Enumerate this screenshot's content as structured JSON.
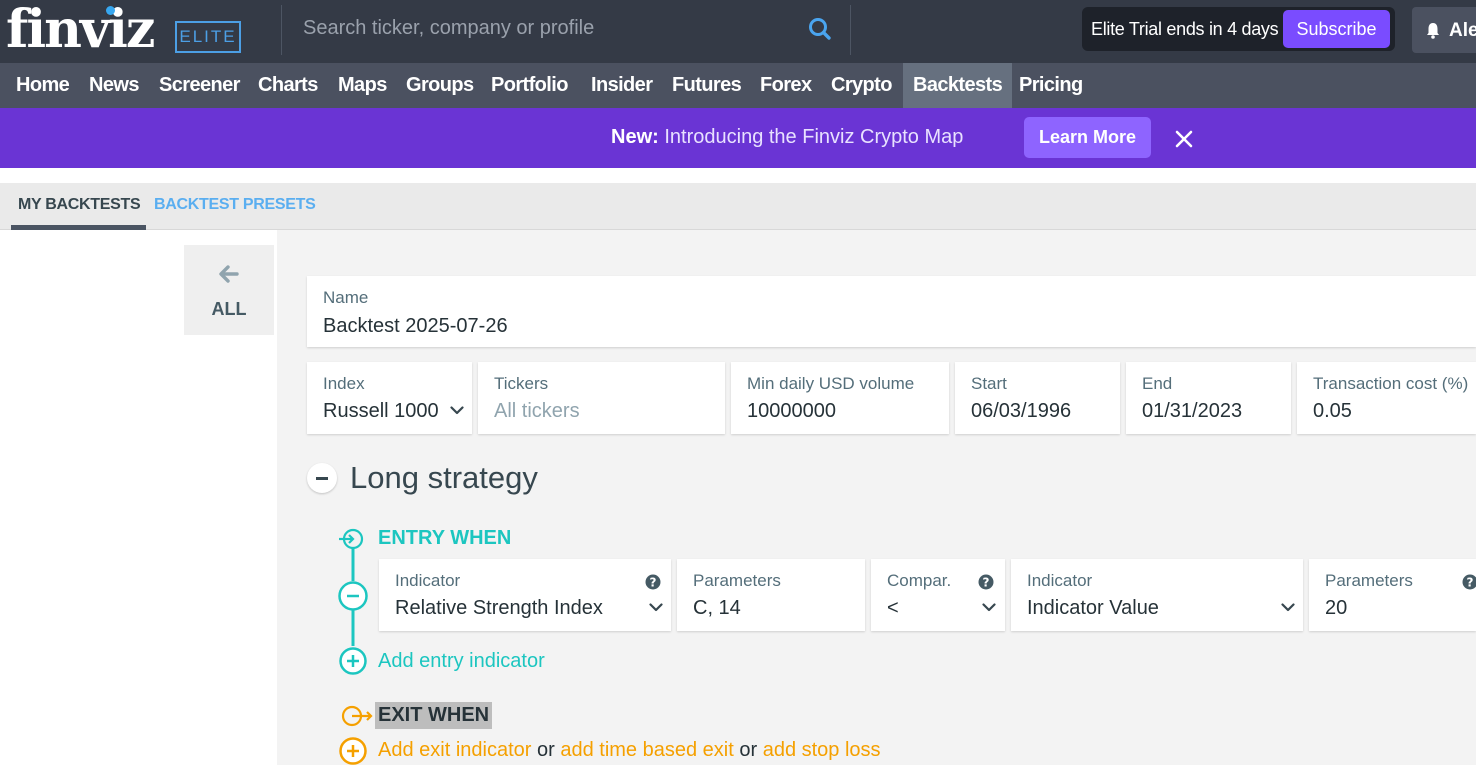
{
  "header": {
    "logo": "finviz",
    "badge": "ELITE",
    "search_placeholder": "Search ticker, company or profile",
    "trial_text": "Elite Trial ends in 4 days",
    "subscribe_label": "Subscribe",
    "user_label": "Ale"
  },
  "nav": [
    "Home",
    "News",
    "Screener",
    "Charts",
    "Maps",
    "Groups",
    "Portfolio",
    "Insider",
    "Futures",
    "Forex",
    "Crypto",
    "Backtests",
    "Pricing"
  ],
  "nav_active": "Backtests",
  "promo": {
    "prefix": "New:",
    "text": "Introducing the Finviz Crypto Map",
    "button": "Learn More"
  },
  "tabs": {
    "my_backtests": "MY BACKTESTS",
    "presets": "BACKTEST PRESETS"
  },
  "back_label": "ALL",
  "form": {
    "name": {
      "label": "Name",
      "value": "Backtest 2025-07-26"
    },
    "index": {
      "label": "Index",
      "value": "Russell 1000"
    },
    "tickers": {
      "label": "Tickers",
      "placeholder": "All tickers"
    },
    "min_volume": {
      "label": "Min daily USD volume",
      "value": "10000000"
    },
    "start": {
      "label": "Start",
      "value": "06/03/1996"
    },
    "end": {
      "label": "End",
      "value": "01/31/2023"
    },
    "transaction_cost": {
      "label": "Transaction cost (%)",
      "value": "0.05"
    }
  },
  "strategy": {
    "title": "Long strategy",
    "entry_when": "ENTRY WHEN",
    "entry_row": {
      "indicator_label": "Indicator",
      "indicator_value": "Relative Strength Index",
      "params_label": "Parameters",
      "params_value": "C, 14",
      "compare_label": "Compar.",
      "compare_value": "<",
      "indicator2_label": "Indicator",
      "indicator2_value": "Indicator Value",
      "params2_label": "Parameters",
      "params2_value": "20"
    },
    "add_entry": "Add entry indicator",
    "exit_when": "EXIT WHEN",
    "exit_links": {
      "add_exit": "Add exit indicator",
      "or1": "or",
      "time_exit": "add time based exit",
      "or2": "or",
      "stop_loss": "add stop loss"
    }
  },
  "colors": {
    "accent_teal": "#1cc6c0",
    "accent_orange": "#f5a000",
    "promo_purple": "#6a34d4",
    "link_blue": "#5aaef0"
  }
}
